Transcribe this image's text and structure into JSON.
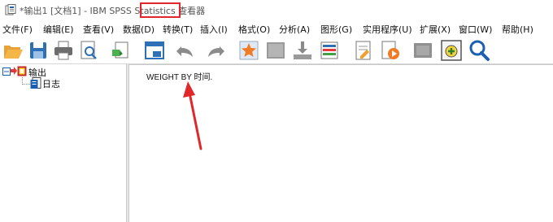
{
  "window": {
    "title": "*输出1 [文档1] - IBM SPSS Statistics 查看器",
    "highlight_label": "查看器"
  },
  "menu": {
    "items": [
      {
        "label": "文件(F)",
        "name": "file"
      },
      {
        "label": "编辑(E)",
        "name": "edit"
      },
      {
        "label": "查看(V)",
        "name": "view"
      },
      {
        "label": "数据(D)",
        "name": "data"
      },
      {
        "label": "转换(T)",
        "name": "transform"
      },
      {
        "label": "插入(I)",
        "name": "insert"
      },
      {
        "label": "格式(O)",
        "name": "format"
      },
      {
        "label": "分析(A)",
        "name": "analyze"
      },
      {
        "label": "图形(G)",
        "name": "graphs"
      },
      {
        "label": "实用程序(U)",
        "name": "utilities"
      },
      {
        "label": "扩展(X)",
        "name": "extensions"
      },
      {
        "label": "窗口(W)",
        "name": "window"
      },
      {
        "label": "帮助(H)",
        "name": "help"
      }
    ]
  },
  "toolbar": {
    "buttons": [
      "open-icon",
      "save-icon",
      "print-icon",
      "print-preview-icon",
      "export-icon",
      "recall-dialog-icon",
      "undo-icon",
      "redo-icon",
      "goto-data-icon",
      "goto-case-icon",
      "goto-variable-icon",
      "variables-icon",
      "designate-window-icon",
      "run-script-icon",
      "hide-icon",
      "zoom-in-icon",
      "search-icon"
    ]
  },
  "outline": {
    "root_label": "输出",
    "child_label": "日志"
  },
  "content": {
    "syntax_text": "WEIGHT BY 时间."
  },
  "colors": {
    "annotation_red": "#e0282a",
    "accent_blue": "#1b5fb3"
  }
}
